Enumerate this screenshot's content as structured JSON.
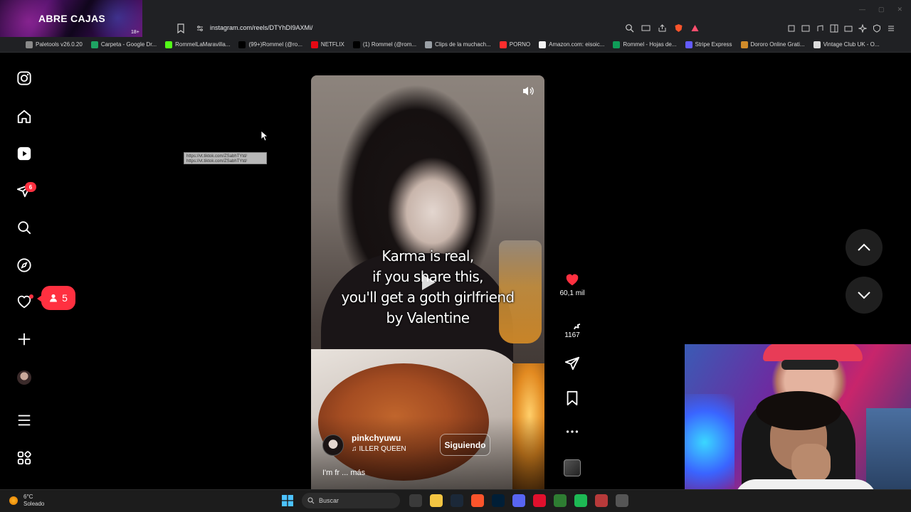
{
  "browser": {
    "overlay_title": "ABRE CAJAS",
    "overlay_badge": "18+",
    "url": "instagram.com/reels/DTYhDI9AXMi/",
    "bookmarks": [
      {
        "label": "Paletools v26.0.20",
        "color": "#8a8a8a"
      },
      {
        "label": "Carpeta - Google Dr...",
        "color": "#1fa463"
      },
      {
        "label": "RommelLaMaravilla...",
        "color": "#53fc18"
      },
      {
        "label": "(99+)Rommel (@ro...",
        "color": "#000000"
      },
      {
        "label": "NETFLIX",
        "color": "#e50914"
      },
      {
        "label": "(1) Rommel (@rom...",
        "color": "#000000"
      },
      {
        "label": "Clips de la muchach...",
        "color": "#9aa0a6"
      },
      {
        "label": "PORNO",
        "color": "#ff2d2d"
      },
      {
        "label": "Amazon.com: eisoic...",
        "color": "#f3f3f3"
      },
      {
        "label": "Rommel - Hojas de...",
        "color": "#0f9d58"
      },
      {
        "label": "Stripe Express",
        "color": "#635bff"
      },
      {
        "label": "Dororo Online Grati...",
        "color": "#d08b2a"
      },
      {
        "label": "Vintage Club UK - O...",
        "color": "#dddddd"
      }
    ]
  },
  "sidebar": {
    "dm_badge": "6",
    "notif_count": "5"
  },
  "tooltip": {
    "line1": "https://vt.tiktok.com/ZSabhTYtd/",
    "line2": "https://vt.tiktok.com/ZSabhTYtd/"
  },
  "reel": {
    "caption": [
      "Karma is real,",
      "if you share this,",
      "you'll get a goth girlfriend",
      "by Valentine"
    ],
    "author": "pinkchyuwu",
    "song": "ILLER QUEEN",
    "follow_label": "Siguiendo",
    "description": "I'm fr ... más"
  },
  "actions": {
    "likes": "60,1 mil",
    "comments": "1167"
  },
  "taskbar": {
    "temp": "6°C",
    "weather": "Soleado",
    "search_placeholder": "Buscar"
  },
  "colors": {
    "accent_red": "#ff3040",
    "page_bg": "#000000"
  }
}
